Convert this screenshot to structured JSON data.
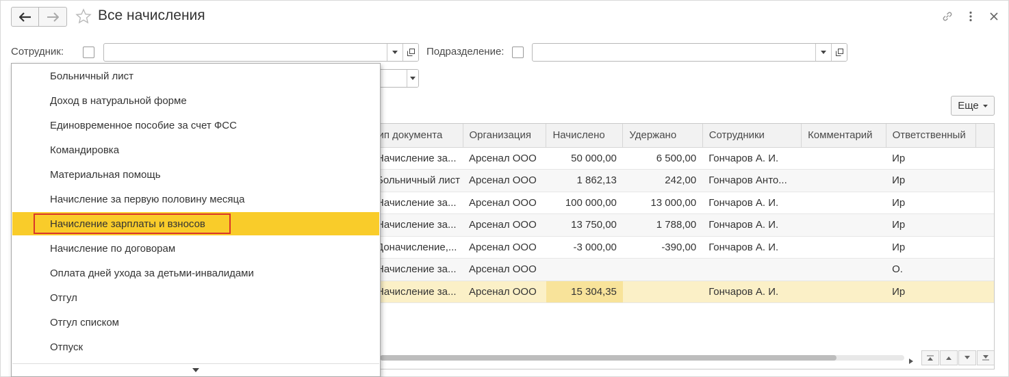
{
  "window": {
    "title": "Все начисления"
  },
  "filters": {
    "employee_label": "Сотрудник:",
    "employee_value": "",
    "department_label": "Подразделение:",
    "department_value": ""
  },
  "toolbar": {
    "more_label": "Еще"
  },
  "table": {
    "columns": [
      "Тип документа",
      "Организация",
      "Начислено",
      "Удержано",
      "Сотрудники",
      "Комментарий",
      "Ответственный"
    ],
    "rows": [
      {
        "type": "Начисление за...",
        "org": "Арсенал ООО",
        "accrued": "50 000,00",
        "withheld": "6 500,00",
        "employees": "Гончаров А. И.",
        "comment": "",
        "resp": "Ир"
      },
      {
        "type": "Больничный лист",
        "org": "Арсенал ООО",
        "accrued": "1 862,13",
        "withheld": "242,00",
        "employees": "Гончаров Анто...",
        "comment": "",
        "resp": "Ир"
      },
      {
        "type": "Начисление за...",
        "org": "Арсенал ООО",
        "accrued": "100 000,00",
        "withheld": "13 000,00",
        "employees": "Гончаров А. И.",
        "comment": "",
        "resp": "Ир"
      },
      {
        "type": "Начисление за...",
        "org": "Арсенал ООО",
        "accrued": "13 750,00",
        "withheld": "1 788,00",
        "employees": "Гончаров А. И.",
        "comment": "",
        "resp": "Ир"
      },
      {
        "type": "Доначисление,...",
        "org": "Арсенал ООО",
        "accrued": "-3 000,00",
        "withheld": "-390,00",
        "employees": "Гончаров А. И.",
        "comment": "",
        "resp": "Ир"
      },
      {
        "type": "Начисление за...",
        "org": "Арсенал ООО",
        "accrued": "",
        "withheld": "",
        "employees": "",
        "comment": "",
        "resp": "О."
      },
      {
        "type": "Начисление за...",
        "org": "Арсенал ООО",
        "accrued": "15 304,35",
        "withheld": "",
        "employees": "Гончаров А. И.",
        "comment": "",
        "resp": "Ир"
      }
    ],
    "selected_row": 6
  },
  "dropdown": {
    "items": [
      "Больничный лист",
      "Доход в натуральной форме",
      "Единовременное пособие за счет ФСС",
      "Командировка",
      "Материальная помощь",
      "Начисление за первую половину месяца",
      "Начисление зарплаты и взносов",
      "Начисление по договорам",
      "Оплата дней ухода за детьми-инвалидами",
      "Отгул",
      "Отгул списком",
      "Отпуск"
    ],
    "active_index": 6
  },
  "colors": {
    "accent_yellow": "#f9cc2a",
    "highlight_red": "#d9352a",
    "selected_row": "#fbf0c7"
  }
}
